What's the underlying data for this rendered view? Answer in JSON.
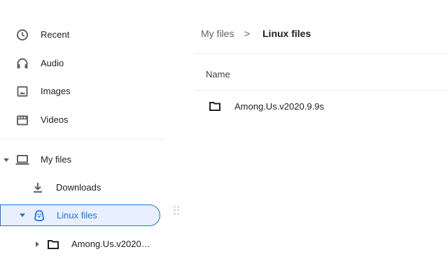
{
  "sidebar": {
    "recents": [
      {
        "label": "Recent",
        "icon": "clock-icon"
      },
      {
        "label": "Audio",
        "icon": "headphones-icon"
      },
      {
        "label": "Images",
        "icon": "image-icon"
      },
      {
        "label": "Videos",
        "icon": "film-icon"
      }
    ],
    "my_files": {
      "label": "My files",
      "icon": "laptop-icon",
      "expanded": true
    },
    "downloads": {
      "label": "Downloads",
      "icon": "download-icon"
    },
    "linux_files": {
      "label": "Linux files",
      "icon": "penguin-icon",
      "expanded": true,
      "selected": true
    },
    "linux_child": {
      "label": "Among.Us.v2020…",
      "icon": "folder-icon",
      "expanded": false
    }
  },
  "breadcrumb": {
    "parent": "My files",
    "separator": ">",
    "current": "Linux files"
  },
  "file_list": {
    "columns": [
      "Name"
    ],
    "rows": [
      {
        "name": "Among.Us.v2020.9.9s",
        "icon": "folder-icon"
      }
    ]
  },
  "colors": {
    "accent": "#1a73e8",
    "selected_bg": "#e8f0fe",
    "icon_gray": "#5f6368",
    "divider": "#e8eaed"
  }
}
